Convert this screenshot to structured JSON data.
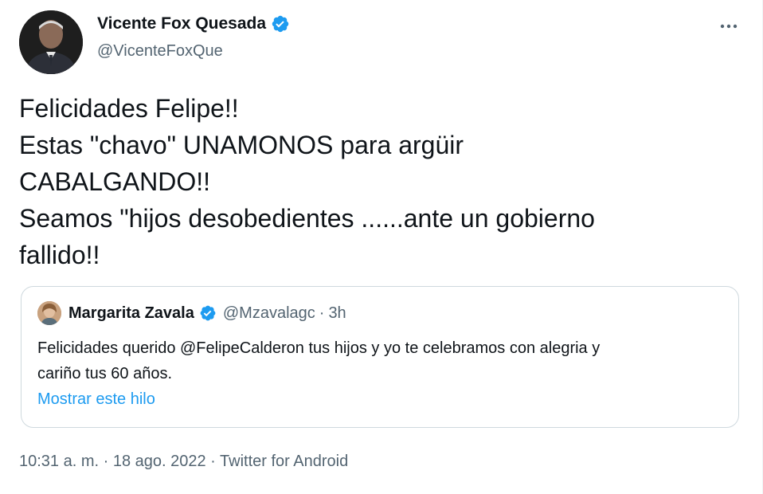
{
  "author": {
    "display_name": "Vicente Fox Quesada",
    "handle": "@VicenteFoxQue",
    "verified": true,
    "avatar_icon": "profile-photo"
  },
  "tweet": {
    "lines": [
      "Felicidades Felipe!!",
      "Estas \"chavo\" UNAMONOS para argüir",
      "CABALGANDO!!",
      "Seamos \"hijos desobedientes ......ante un gobierno",
      "fallido!!"
    ]
  },
  "quoted": {
    "display_name": "Margarita Zavala",
    "handle": "@Mzavalagc",
    "separator": "·",
    "time": "3h",
    "verified": true,
    "lines": [
      "Felicidades querido @FelipeCalderon tus hijos y yo te celebramos con alegria y",
      "cariño tus 60 años."
    ],
    "show_thread": "Mostrar este hilo"
  },
  "meta": {
    "time": "10:31 a. m.",
    "sep1": " · ",
    "date": "18 ago. 2022",
    "sep2": " · ",
    "source": "Twitter for Android"
  },
  "icons": {
    "more": "more-horizontal-icon",
    "verified": "verified-badge-icon"
  },
  "colors": {
    "accent": "#1d9bf0",
    "text": "#0f1419",
    "secondary": "#536471",
    "border": "#cfd9de"
  }
}
